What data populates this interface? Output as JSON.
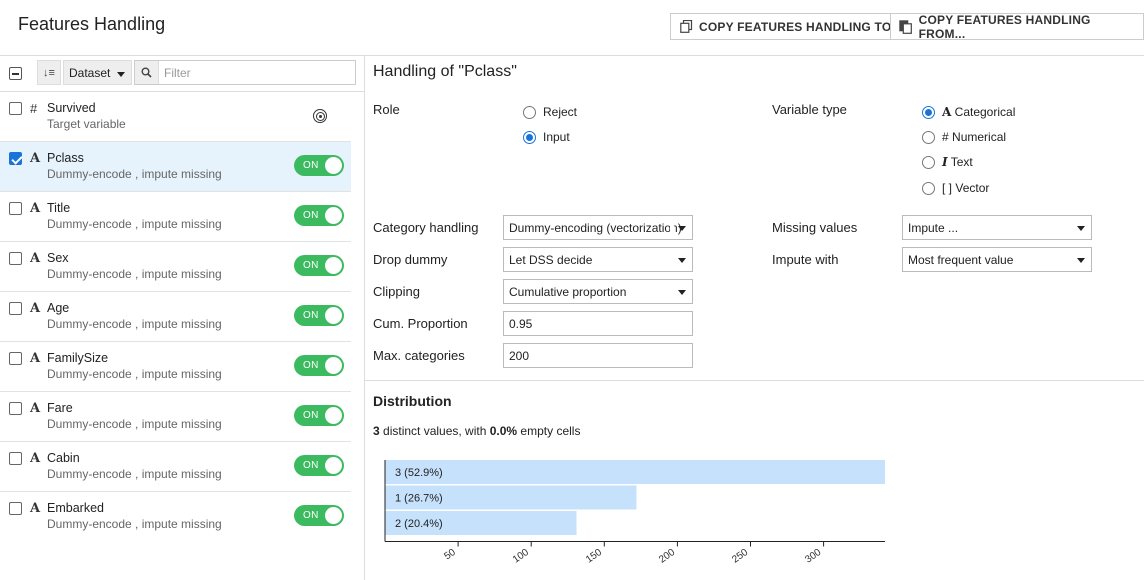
{
  "header": {
    "title": "Features Handling",
    "copy_to_label": "COPY FEATURES HANDLING TO...",
    "copy_from_label": "COPY FEATURES HANDLING FROM..."
  },
  "toolbar": {
    "sort_glyph": "↓≡",
    "dataset_select": "Dataset",
    "filter_placeholder": "Filter"
  },
  "features": [
    {
      "type_glyph": "#",
      "name": "Survived",
      "desc": "Target variable",
      "selected": false,
      "target": true
    },
    {
      "type_glyph": "A",
      "name": "Pclass",
      "desc": "Dummy-encode , impute missing",
      "selected": true,
      "toggle": "ON"
    },
    {
      "type_glyph": "A",
      "name": "Title",
      "desc": "Dummy-encode , impute missing",
      "selected": false,
      "toggle": "ON"
    },
    {
      "type_glyph": "A",
      "name": "Sex",
      "desc": "Dummy-encode , impute missing",
      "selected": false,
      "toggle": "ON"
    },
    {
      "type_glyph": "A",
      "name": "Age",
      "desc": "Dummy-encode , impute missing",
      "selected": false,
      "toggle": "ON"
    },
    {
      "type_glyph": "A",
      "name": "FamilySize",
      "desc": "Dummy-encode , impute missing",
      "selected": false,
      "toggle": "ON"
    },
    {
      "type_glyph": "A",
      "name": "Fare",
      "desc": "Dummy-encode , impute missing",
      "selected": false,
      "toggle": "ON"
    },
    {
      "type_glyph": "A",
      "name": "Cabin",
      "desc": "Dummy-encode , impute missing",
      "selected": false,
      "toggle": "ON"
    },
    {
      "type_glyph": "A",
      "name": "Embarked",
      "desc": "Dummy-encode , impute missing",
      "selected": false,
      "toggle": "ON"
    }
  ],
  "panel": {
    "title": "Handling of \"Pclass\"",
    "role": {
      "label": "Role",
      "options": [
        "Reject",
        "Input"
      ],
      "selected": "Input"
    },
    "variable_type": {
      "label": "Variable type",
      "options": [
        {
          "glyph": "A",
          "label": "Categorical"
        },
        {
          "glyph": "#",
          "label": "Numerical"
        },
        {
          "glyph": "I",
          "label": "Text"
        },
        {
          "glyph": "[ ]",
          "label": "Vector"
        }
      ],
      "selected": "Categorical"
    },
    "category_handling": {
      "label": "Category handling",
      "value": "Dummy-encoding (vectorization)"
    },
    "drop_dummy": {
      "label": "Drop dummy",
      "value": "Let DSS decide"
    },
    "clipping": {
      "label": "Clipping",
      "value": "Cumulative proportion"
    },
    "cum_proportion": {
      "label": "Cum. Proportion",
      "value": "0.95"
    },
    "max_categories": {
      "label": "Max. categories",
      "value": "200"
    },
    "missing_values": {
      "label": "Missing values",
      "value": "Impute ..."
    },
    "impute_with": {
      "label": "Impute with",
      "value": "Most frequent value"
    }
  },
  "distribution": {
    "title": "Distribution",
    "distinct_count": "3",
    "distinct_text": " distinct values, with ",
    "empty_pct": "0.0%",
    "empty_text": " empty cells"
  },
  "chart_data": {
    "type": "bar",
    "orientation": "horizontal",
    "categories": [
      "3 (52.9%)",
      "1 (26.7%)",
      "2 (20.4%)"
    ],
    "values": [
      342,
      172,
      131
    ],
    "xlim": [
      0,
      342
    ],
    "xticks": [
      50,
      100,
      150,
      200,
      250,
      300
    ],
    "bar_color": "#c5e1fb"
  }
}
